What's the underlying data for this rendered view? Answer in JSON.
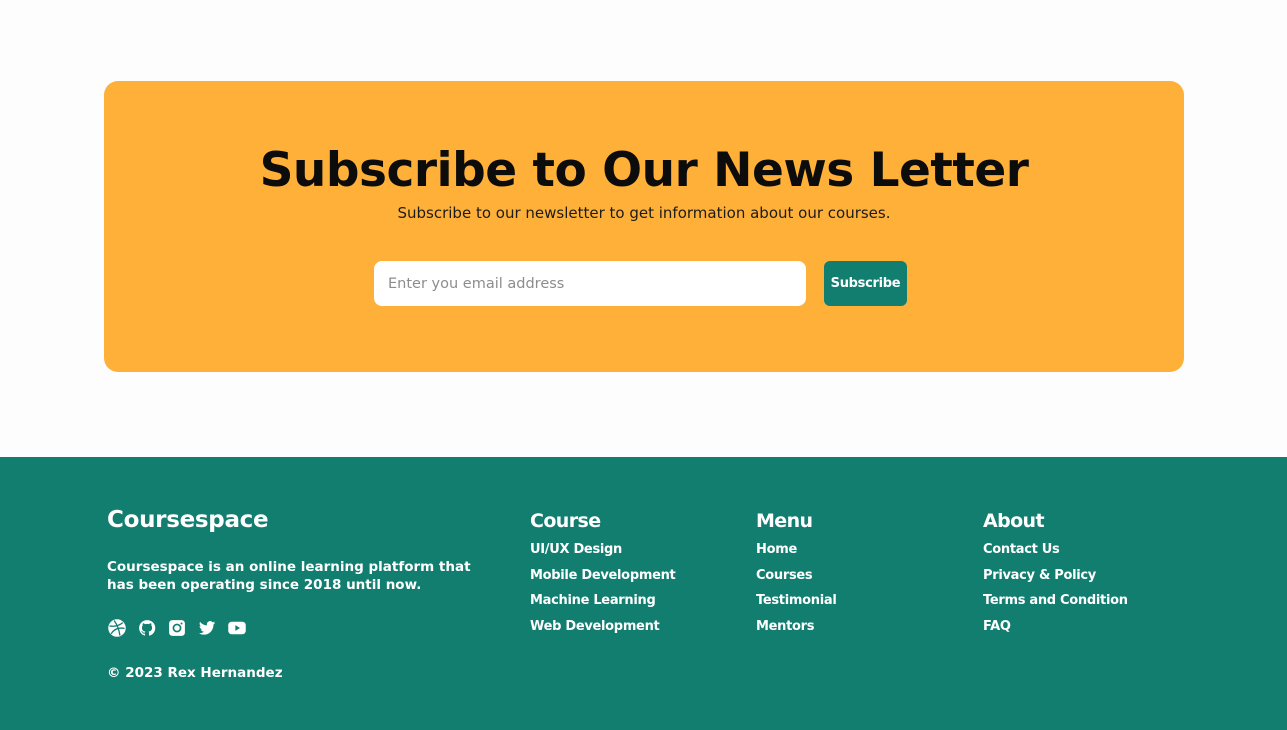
{
  "newsletter": {
    "title": "Subscribe to Our News Letter",
    "subtitle": "Subscribe to our newsletter to get information about our courses.",
    "email_placeholder": "Enter you email address",
    "subscribe_label": "Subscribe"
  },
  "footer": {
    "brand": "Coursespace",
    "description": "Coursespace is an online learning platform that has been operating since 2018 until now.",
    "socials": [
      "dribbble-icon",
      "github-icon",
      "instagram-icon",
      "twitter-icon",
      "youtube-icon"
    ],
    "copyright": "© 2023 Rex Hernandez",
    "columns": [
      {
        "heading": "Course",
        "items": [
          "UI/UX Design",
          "Mobile Development",
          "Machine Learning",
          "Web Development"
        ]
      },
      {
        "heading": "Menu",
        "items": [
          "Home",
          "Courses",
          "Testimonial",
          "Mentors"
        ]
      },
      {
        "heading": "About",
        "items": [
          "Contact Us",
          "Privacy & Policy",
          "Terms and Condition",
          "FAQ"
        ]
      }
    ]
  },
  "colors": {
    "accent_orange": "#ffb039",
    "brand_teal": "#127e70",
    "background": "#fdfdfd"
  }
}
